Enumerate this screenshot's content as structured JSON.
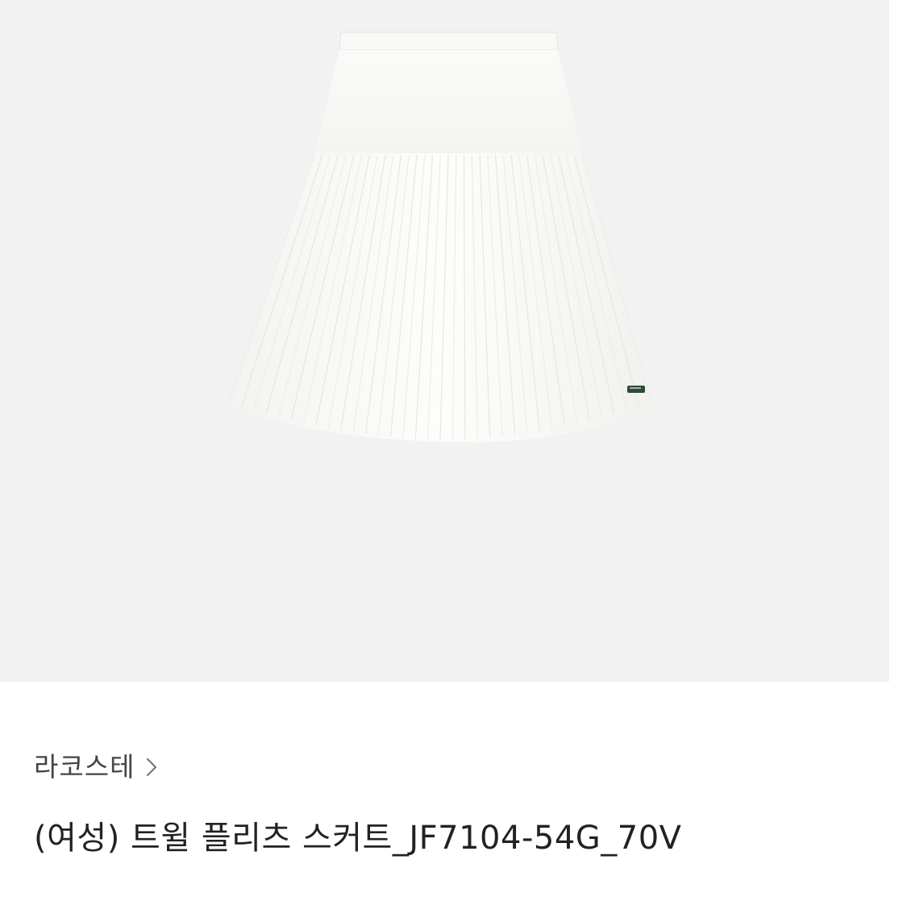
{
  "product": {
    "image_alt": "white pleated skirt",
    "image_bg_color": "#f2f2f2",
    "skirt_color": "#fbfbf9",
    "brand": "라코스테",
    "title": "(여성) 트윌 플리츠 스커트_JF7104-54G_70V"
  },
  "icons": {
    "brand_chevron": "chevron-right-icon",
    "logo": "crocodile-logo"
  }
}
